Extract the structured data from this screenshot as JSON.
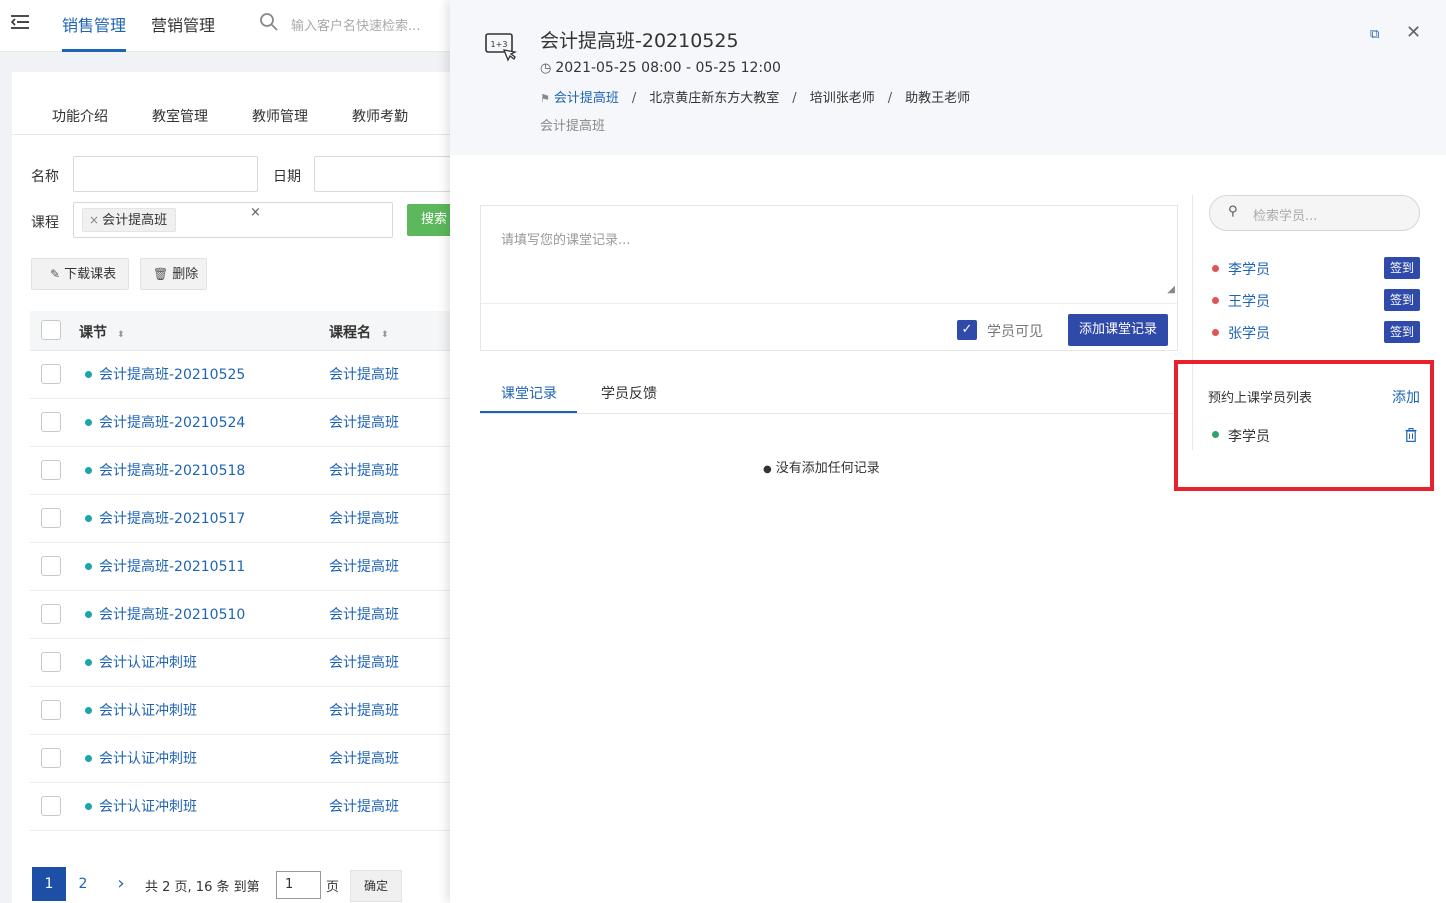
{
  "topbar": {
    "tabs": [
      {
        "label": "销售管理",
        "active": true
      },
      {
        "label": "营销管理",
        "active": false
      }
    ],
    "search_placeholder": "输入客户名快速检索..."
  },
  "subtabs": [
    "功能介绍",
    "教室管理",
    "教师管理",
    "教师考勤"
  ],
  "filters": {
    "name_label": "名称",
    "date_label": "日期",
    "course_label": "课程",
    "course_tag": "会计提高班",
    "tag_remove": "×",
    "clear": "×",
    "search_button": "搜索"
  },
  "toolbar": {
    "download_label": "下载课表",
    "delete_label": "删除"
  },
  "table": {
    "columns": [
      "课节",
      "课程名"
    ],
    "sort_glyph": "⬍",
    "rows": [
      {
        "name": "会计提高班-20210525",
        "course": "会计提高班"
      },
      {
        "name": "会计提高班-20210524",
        "course": "会计提高班"
      },
      {
        "name": "会计提高班-20210518",
        "course": "会计提高班"
      },
      {
        "name": "会计提高班-20210517",
        "course": "会计提高班"
      },
      {
        "name": "会计提高班-20210511",
        "course": "会计提高班"
      },
      {
        "name": "会计提高班-20210510",
        "course": "会计提高班"
      },
      {
        "name": "会计认证冲刺班",
        "course": "会计提高班"
      },
      {
        "name": "会计认证冲刺班",
        "course": "会计提高班"
      },
      {
        "name": "会计认证冲刺班",
        "course": "会计提高班"
      },
      {
        "name": "会计认证冲刺班",
        "course": "会计提高班"
      }
    ]
  },
  "pagination": {
    "current": "1",
    "next_page": "2",
    "next_arrow": "›",
    "summary": "共 2 页, 16 条 到第",
    "input_value": "1",
    "page_suffix": "页",
    "confirm": "确定"
  },
  "drawer": {
    "title": "会计提高班-20210525",
    "time": "2021-05-25 08:00 - 05-25 12:00",
    "crumbs": {
      "course": "会计提高班",
      "classroom": "北京黄庄新东方大教室",
      "teacher": "培训张老师",
      "assistant": "助教王老师",
      "sep": "/"
    },
    "subtitle": "会计提高班",
    "expand_glyph": "⧉",
    "close_glyph": "✕",
    "note_placeholder": "请填写您的课堂记录...",
    "visible_label": "学员可见",
    "visible_checked": true,
    "add_note_button": "添加课堂记录",
    "tabs": [
      {
        "label": "课堂记录",
        "active": true
      },
      {
        "label": "学员反馈",
        "active": false
      }
    ],
    "empty_text": "没有添加任何记录",
    "student_search_placeholder": "检索学员...",
    "students": [
      {
        "name": "李学员",
        "action": "签到"
      },
      {
        "name": "王学员",
        "action": "签到"
      },
      {
        "name": "张学员",
        "action": "签到"
      }
    ],
    "booking": {
      "title": "预约上课学员列表",
      "add_label": "添加",
      "students": [
        {
          "name": "李学员"
        }
      ]
    }
  },
  "colors": {
    "accent": "#1e64b4",
    "button_primary": "#2f4aa8",
    "search_green": "#5cb85c",
    "highlight_red": "#e8222c",
    "dot_teal": "#1aa4b0",
    "dot_red": "#e05555",
    "dot_green": "#2ba36b"
  },
  "icons": {
    "menu": "menu-toggle-icon",
    "search": "search-icon",
    "clock": "clock-icon",
    "flag": "course-icon",
    "expand": "expand-icon",
    "close": "close-icon",
    "trash": "trash-icon",
    "lightbulb": "lightbulb-icon",
    "classroom": "classroom-board-icon"
  }
}
